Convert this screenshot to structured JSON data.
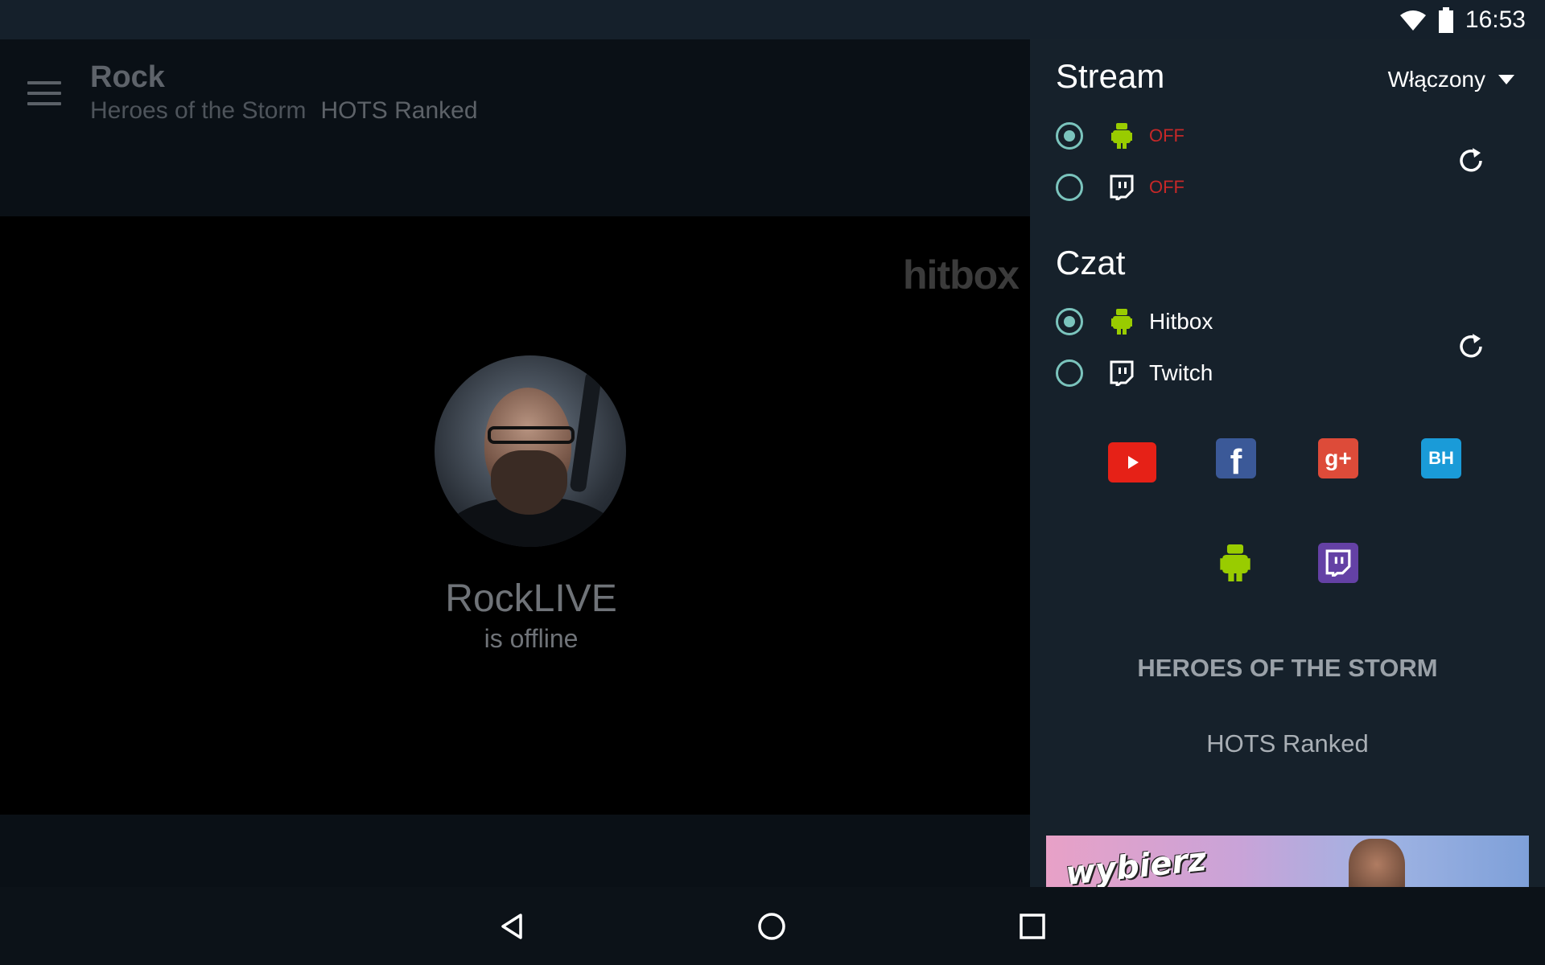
{
  "status_bar": {
    "time": "16:53"
  },
  "toolbar": {
    "title": "Rock",
    "subtitle_game": "Heroes of the Storm",
    "subtitle_tag": "HOTS Ranked"
  },
  "player": {
    "watermark": "hitbox",
    "channel_name": "RockLIVE",
    "channel_status": "is offline"
  },
  "drawer": {
    "stream": {
      "title": "Stream",
      "dropdown_value": "Włączony",
      "options": [
        {
          "service": "hitbox",
          "status": "OFF",
          "selected": true
        },
        {
          "service": "twitch",
          "status": "OFF",
          "selected": false
        }
      ]
    },
    "chat": {
      "title": "Czat",
      "options": [
        {
          "service": "hitbox",
          "label": "Hitbox",
          "selected": true
        },
        {
          "service": "twitch",
          "label": "Twitch",
          "selected": false
        }
      ]
    },
    "socials": [
      "youtube-icon",
      "facebook-icon",
      "google-plus-icon",
      "vk-icon",
      "hitbox-icon",
      "twitch-icon"
    ],
    "social_colors": {
      "youtube": "#e62117",
      "facebook": "#3b5998",
      "google_plus": "#dd4b39",
      "vk": "#1a9bd8",
      "hitbox": "#99cc00",
      "twitch": "#6441a5"
    },
    "game_title": "HEROES OF THE STORM",
    "game_tag": "HOTS Ranked",
    "ad_text": "wybierz"
  },
  "colors": {
    "accent": "#7bc4bd",
    "off_red": "#c62828",
    "drawer_bg": "#16212b"
  }
}
